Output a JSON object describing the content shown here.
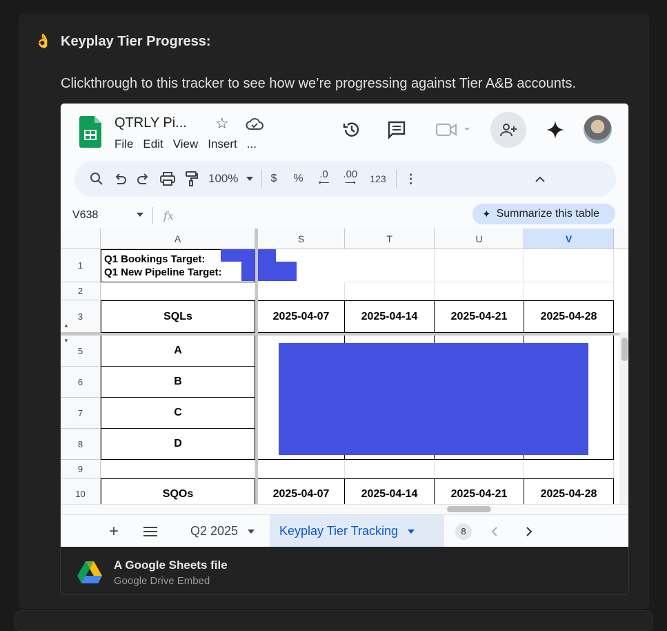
{
  "message": {
    "emoji_icon": "ok-hand-icon",
    "heading": "Keyplay Tier Progress:",
    "body": "Clickthrough to this tracker to see how we’re progressing against Tier A&B accounts."
  },
  "sheet": {
    "title": "QTRLY Pi...",
    "menu": [
      "File",
      "Edit",
      "View",
      "Insert",
      "..."
    ],
    "toolbar": {
      "zoom": "100%",
      "currency": "$",
      "percent": "%",
      "decrease_decimal": ".0",
      "increase_decimal": ".00",
      "number_format": "123"
    },
    "formula_bar": {
      "cell_ref": "V638",
      "fx": "fx",
      "summarize_label": "Summarize this table"
    },
    "columns": [
      "A",
      "S",
      "T",
      "U",
      "V"
    ],
    "selected_column": "V",
    "rows": {
      "r1": {
        "num": "1",
        "line1": "Q1 Bookings Target:",
        "line2": "Q1 New Pipeline Target:"
      },
      "r2": {
        "num": "2"
      },
      "r3": {
        "num": "3",
        "label": "SQLs",
        "dates": [
          "2025-04-07",
          "2025-04-14",
          "2025-04-21",
          "2025-04-28"
        ]
      },
      "r5": {
        "num": "5",
        "label": "A"
      },
      "r6": {
        "num": "6",
        "label": "B"
      },
      "r7": {
        "num": "7",
        "label": "C"
      },
      "r8": {
        "num": "8",
        "label": "D"
      },
      "r9": {
        "num": "9"
      },
      "r10": {
        "num": "10",
        "label": "SQOs",
        "dates": [
          "2025-04-07",
          "2025-04-14",
          "2025-04-21",
          "2025-04-28"
        ]
      }
    },
    "tabs": {
      "prev_tab": "Q2 2025",
      "active_tab": "Keyplay Tier Tracking",
      "hidden_count": "8"
    },
    "colors": {
      "redaction": "#4350e0",
      "accent": "#0b57d0"
    }
  },
  "footer": {
    "title": "A Google Sheets file",
    "subtitle": "Google Drive Embed"
  }
}
